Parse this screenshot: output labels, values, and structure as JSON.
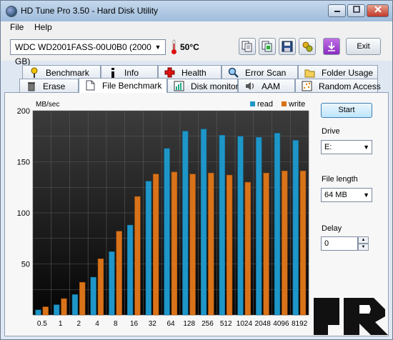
{
  "window": {
    "title": "HD Tune Pro 3.50 - Hard Disk Utility"
  },
  "menu": {
    "file": "File",
    "help": "Help"
  },
  "toolbar": {
    "drive": "WDC WD2001FASS-00U0B0 (2000 GB)",
    "temperature": "50°C",
    "exit_label": "Exit",
    "icons": [
      "copy-text-icon",
      "copy-screenshot-icon",
      "save-icon",
      "options-icon",
      "download-icon"
    ]
  },
  "tabs_row1": [
    {
      "label": "Benchmark",
      "icon": "benchmark-icon"
    },
    {
      "label": "Info",
      "icon": "info-icon"
    },
    {
      "label": "Health",
      "icon": "health-icon"
    },
    {
      "label": "Error Scan",
      "icon": "error-scan-icon"
    },
    {
      "label": "Folder Usage",
      "icon": "folder-icon"
    }
  ],
  "tabs_row2": [
    {
      "label": "Erase",
      "icon": "trash-icon"
    },
    {
      "label": "File Benchmark",
      "icon": "file-icon",
      "active": true
    },
    {
      "label": "Disk monitor",
      "icon": "disk-monitor-icon"
    },
    {
      "label": "AAM",
      "icon": "speaker-icon"
    },
    {
      "label": "Random Access",
      "icon": "random-access-icon"
    }
  ],
  "side": {
    "start_label": "Start",
    "drive_label": "Drive",
    "drive_value": "E:",
    "file_length_label": "File length",
    "file_length_value": "64 MB",
    "delay_label": "Delay",
    "delay_value": "0"
  },
  "colors": {
    "read": "#1f96c8",
    "write": "#d9731a",
    "accent": "#3c7fb1"
  },
  "chart_data": {
    "type": "bar",
    "ylabel": "MB/sec",
    "ylim": [
      0,
      200
    ],
    "yticks": [
      50,
      100,
      150,
      200
    ],
    "categories": [
      "0.5",
      "1",
      "2",
      "4",
      "8",
      "16",
      "32",
      "64",
      "128",
      "256",
      "512",
      "1024",
      "2048",
      "4096",
      "8192"
    ],
    "series": [
      {
        "name": "read",
        "values": [
          5,
          10,
          20,
          37,
          62,
          88,
          131,
          163,
          180,
          182,
          176,
          175,
          174,
          178,
          171
        ]
      },
      {
        "name": "write",
        "values": [
          8,
          16,
          32,
          55,
          82,
          116,
          138,
          140,
          138,
          139,
          137,
          130,
          139,
          141,
          141
        ]
      }
    ],
    "legend": "top-right",
    "grid": true
  },
  "logo": {
    "alt": "Legit Reviews"
  }
}
